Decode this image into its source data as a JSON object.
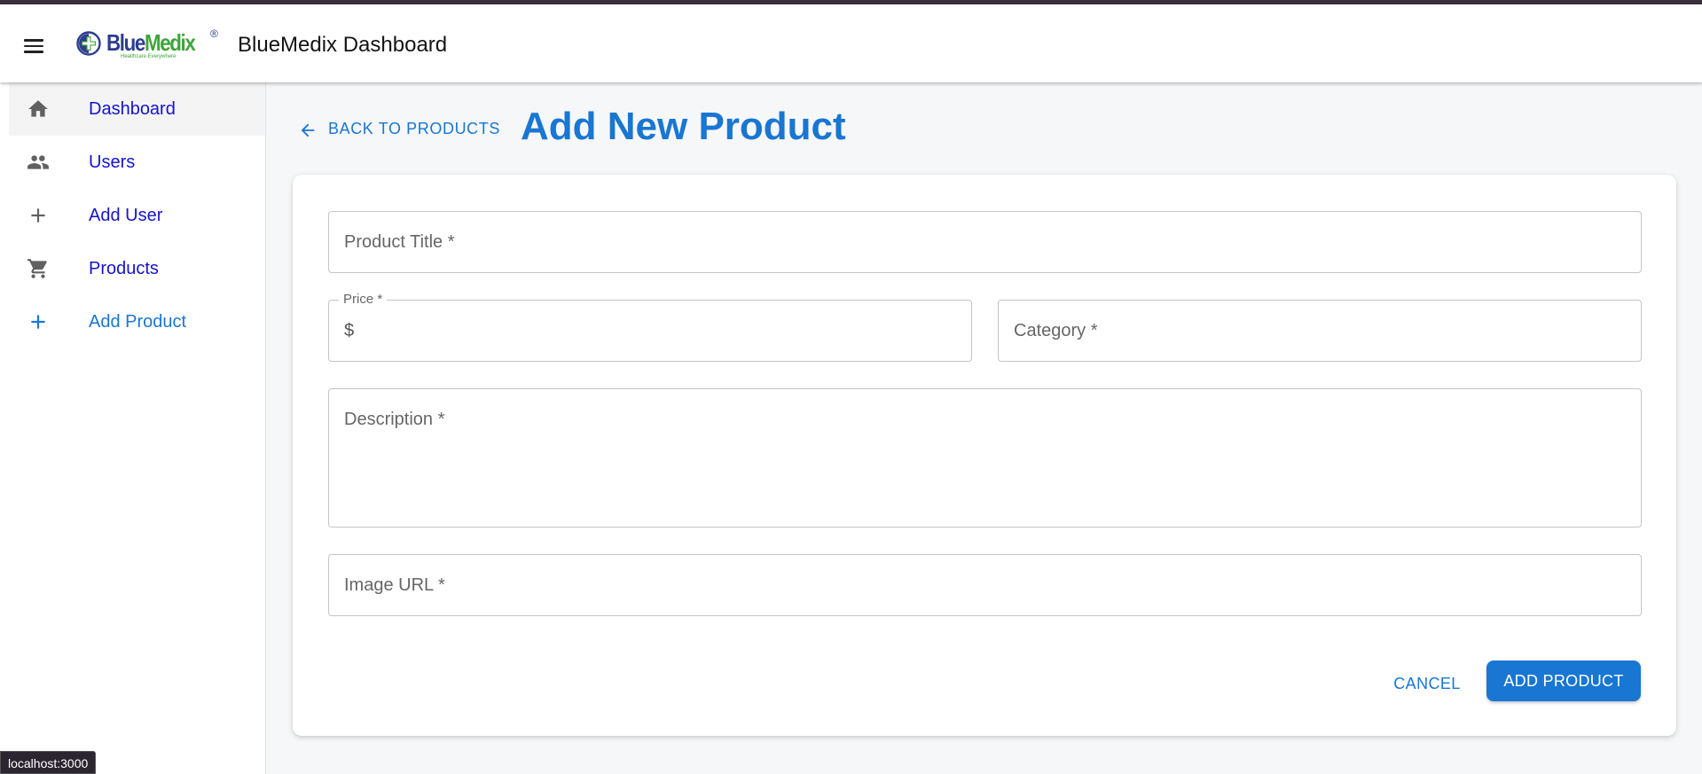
{
  "appbar": {
    "menu_icon": "hamburger-menu-icon",
    "logo": {
      "brand_blue": "Blue",
      "brand_green": "Medix",
      "registered": "®",
      "tagline": "Healthcare Everywhere"
    },
    "title": "BlueMedix Dashboard"
  },
  "sidebar": {
    "items": [
      {
        "label": "Dashboard",
        "icon": "home-icon"
      },
      {
        "label": "Users",
        "icon": "people-icon"
      },
      {
        "label": "Add User",
        "icon": "plus-icon"
      },
      {
        "label": "Products",
        "icon": "cart-icon"
      },
      {
        "label": "Add Product",
        "icon": "plus-icon"
      }
    ]
  },
  "main": {
    "back_label": "BACK TO PRODUCTS",
    "title": "Add New Product",
    "form": {
      "product_title": {
        "placeholder": "Product Title *",
        "value": ""
      },
      "price": {
        "label": "Price *",
        "adornment": "$",
        "value": ""
      },
      "category": {
        "placeholder": "Category *",
        "value": ""
      },
      "description": {
        "placeholder": "Description *",
        "value": ""
      },
      "image_url": {
        "placeholder": "Image URL *",
        "value": ""
      }
    },
    "cancel_label": "CANCEL",
    "submit_label": "ADD PRODUCT"
  },
  "status_bar": {
    "url": "localhost:3000"
  },
  "colors": {
    "primary": "#1976d2",
    "nav_link": "#1414cc",
    "brand_blue": "#2d3d8f",
    "brand_green": "#3ea53a",
    "background": "#f6f7f9"
  }
}
